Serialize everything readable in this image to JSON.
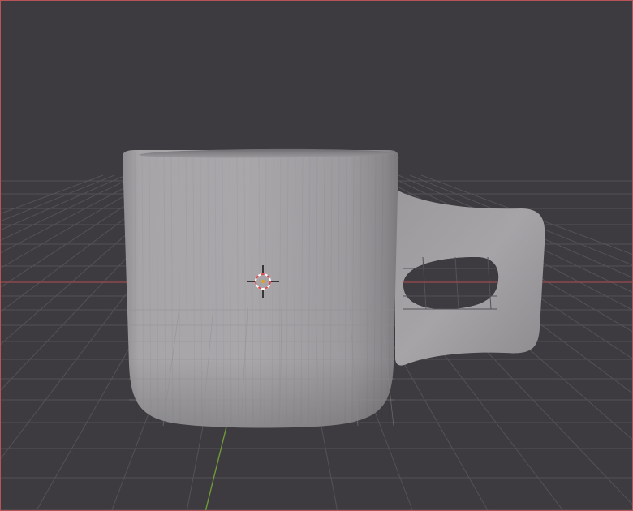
{
  "app": "3D viewport",
  "viewport": {
    "background_color": "#3d3b3f",
    "grid_color": "#555358",
    "x_axis_color": "#9a4a4f",
    "y_axis_color": "#6f9a3a",
    "active_border_color": "#b85458"
  },
  "scene": {
    "object": "mug",
    "object_shading": "solid",
    "object_color": "#a8a6a9",
    "cursor": "3d-cursor-icon"
  }
}
